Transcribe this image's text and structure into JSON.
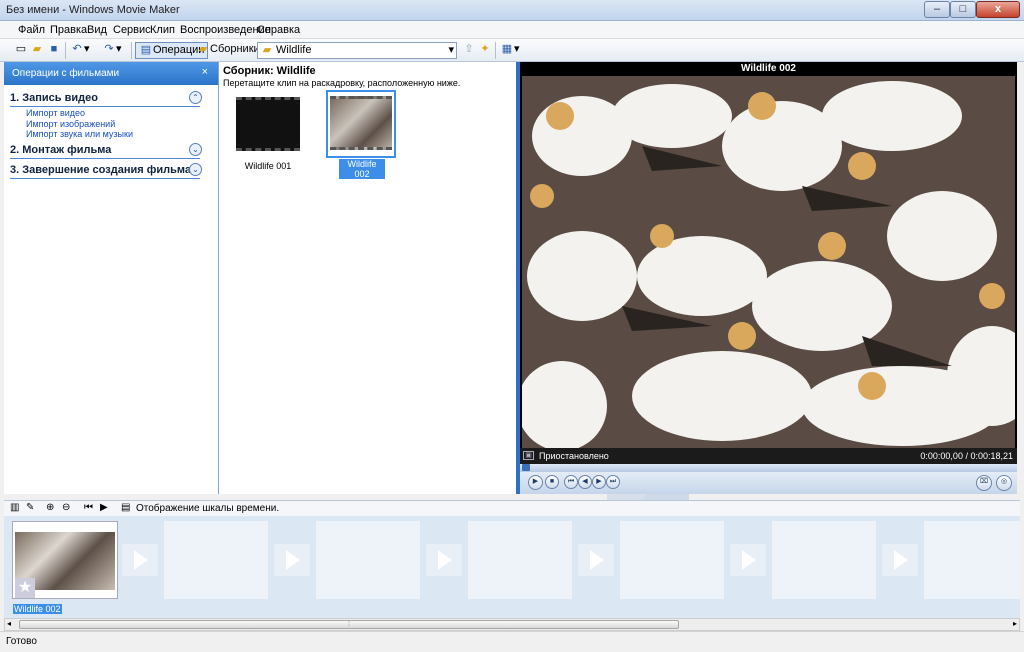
{
  "window": {
    "title": "Без имени - Windows Movie Maker"
  },
  "menu": [
    "Файл",
    "Правка",
    "Вид",
    "Сервис",
    "Клип",
    "Воспроизведение",
    "Справка"
  ],
  "toolbar": {
    "operations_label": "Операции",
    "collections_label": "Сборники",
    "collection_select": "Wildlife"
  },
  "tasks": {
    "header": "Операции с фильмами",
    "close": "×",
    "sections": [
      {
        "title": "1. Запись видео",
        "links": [
          "Импорт видео",
          "Импорт изображений",
          "Импорт звука или музыки"
        ]
      },
      {
        "title": "2. Монтаж фильма",
        "links": []
      },
      {
        "title": "3. Завершение создания фильма",
        "links": []
      }
    ]
  },
  "collection": {
    "title": "Сборник: Wildlife",
    "hint": "Перетащите клип на раскадровку, расположенную ниже.",
    "clips": [
      {
        "name": "Wildlife 001"
      },
      {
        "name": "Wildlife 002"
      }
    ]
  },
  "preview": {
    "title": "Wildlife 002",
    "status": "Приостановлено",
    "time": "0:00:00,00 / 0:00:18,21"
  },
  "storyboard": {
    "bar_label": "Отображение шкалы времени.",
    "first_clip": "Wildlife 002"
  },
  "statusbar": {
    "text": "Готово"
  }
}
